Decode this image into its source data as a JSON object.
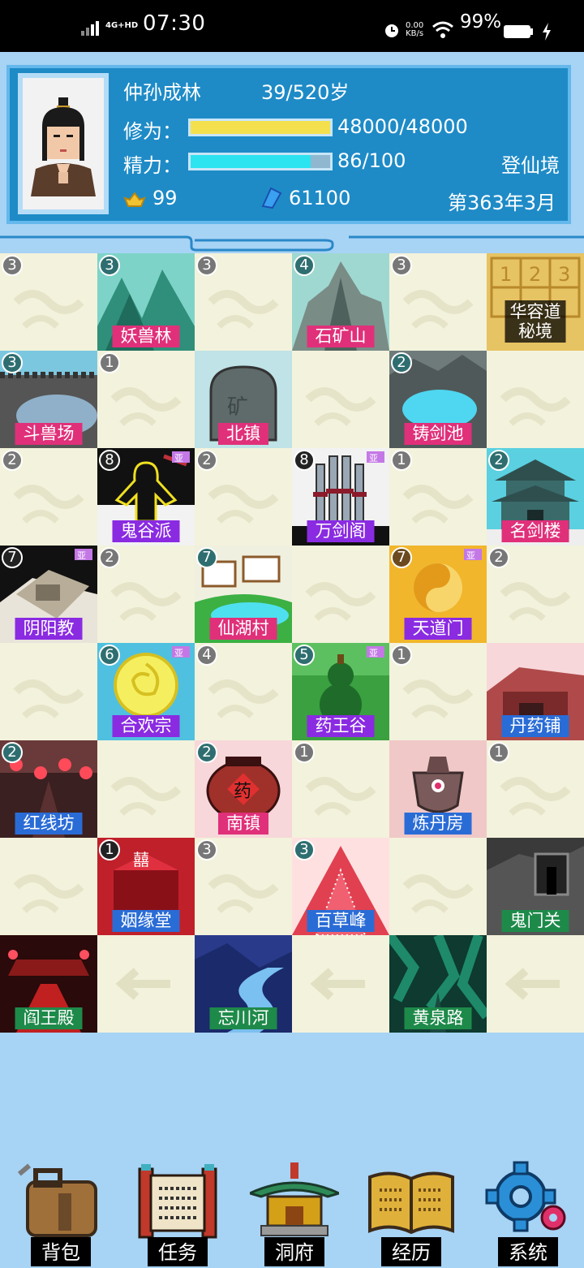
{
  "status_bar": {
    "network": "4G+HD",
    "time": "07:30",
    "net_speed_value": "0.00",
    "net_speed_unit": "KB/s",
    "battery": "99%"
  },
  "profile": {
    "name": "仲孙成林",
    "age": "39/520岁",
    "cultivation_label": "修为：",
    "cultivation_value": "48000/48000",
    "cultivation_progress": 1.0,
    "energy_label": "精力：",
    "energy_value": "86/100",
    "energy_progress": 0.86,
    "realm": "登仙境",
    "gold": "99",
    "spirit_stones": "61100",
    "date": "第363年3月"
  },
  "colors": {
    "panel": "#1e8bc7",
    "cultivation_bar": "#f4e04d",
    "energy_bar": "#2ce4ef",
    "label_pink": "#e0307a",
    "label_purple": "#8a2be2",
    "label_blue": "#2a6cd6",
    "label_green": "#1e8a4a"
  },
  "grid": {
    "rows": [
      [
        {
          "badge": "3",
          "label": "",
          "scene": "empty"
        },
        {
          "badge": "3",
          "label": "妖兽林",
          "scene": "forest",
          "label_color": "pink"
        },
        {
          "badge": "3",
          "label": "",
          "scene": "empty"
        },
        {
          "badge": "4",
          "label": "石矿山",
          "scene": "rock",
          "label_color": "pink"
        },
        {
          "badge": "3",
          "label": "",
          "scene": "empty"
        },
        {
          "badge": "",
          "label": "华容道\n秘境",
          "scene": "puzzle",
          "label_color": "dark"
        }
      ],
      [
        {
          "badge": "3",
          "label": "斗兽场",
          "scene": "arena",
          "label_color": "pink"
        },
        {
          "badge": "1",
          "label": "",
          "scene": "empty"
        },
        {
          "badge": "",
          "label": "北镇",
          "scene": "tomb",
          "label_color": "pink"
        },
        {
          "badge": "",
          "label": "",
          "scene": "empty"
        },
        {
          "badge": "2",
          "label": "铸剑池",
          "scene": "pool",
          "label_color": "pink"
        },
        {
          "badge": "",
          "label": "",
          "scene": "empty"
        }
      ],
      [
        {
          "badge": "2",
          "label": "",
          "scene": "empty"
        },
        {
          "badge": "8",
          "label": "鬼谷派",
          "scene": "ghostvalley",
          "label_color": "purple",
          "crown": true
        },
        {
          "badge": "2",
          "label": "",
          "scene": "empty"
        },
        {
          "badge": "8",
          "label": "万剑阁",
          "scene": "swords",
          "label_color": "purple",
          "crown": true
        },
        {
          "badge": "1",
          "label": "",
          "scene": "empty"
        },
        {
          "badge": "2",
          "label": "名剑楼",
          "scene": "pagoda",
          "label_color": "pink"
        }
      ],
      [
        {
          "badge": "7",
          "label": "阴阳教",
          "scene": "fort",
          "label_color": "purple",
          "crown": true
        },
        {
          "badge": "2",
          "label": "",
          "scene": "empty"
        },
        {
          "badge": "7",
          "label": "仙湖村",
          "scene": "village",
          "label_color": "pink"
        },
        {
          "badge": "",
          "label": "",
          "scene": "empty"
        },
        {
          "badge": "7",
          "label": "天道门",
          "scene": "taiji",
          "label_color": "purple",
          "crown": true
        },
        {
          "badge": "2",
          "label": "",
          "scene": "empty"
        }
      ],
      [
        {
          "badge": "",
          "label": "",
          "scene": "empty"
        },
        {
          "badge": "6",
          "label": "合欢宗",
          "scene": "flower",
          "label_color": "purple",
          "crown": true
        },
        {
          "badge": "4",
          "label": "",
          "scene": "empty"
        },
        {
          "badge": "5",
          "label": "药王谷",
          "scene": "gourd",
          "label_color": "purple",
          "crown": true
        },
        {
          "badge": "1",
          "label": "",
          "scene": "empty"
        },
        {
          "badge": "",
          "label": "丹药铺",
          "scene": "shop",
          "label_color": "blue"
        }
      ],
      [
        {
          "badge": "2",
          "label": "红线坊",
          "scene": "lanterns",
          "label_color": "blue"
        },
        {
          "badge": "",
          "label": "",
          "scene": "empty"
        },
        {
          "badge": "2",
          "label": "南镇",
          "scene": "jar",
          "label_color": "pink"
        },
        {
          "badge": "1",
          "label": "",
          "scene": "empty"
        },
        {
          "badge": "",
          "label": "炼丹房",
          "scene": "cauldron",
          "label_color": "blue"
        },
        {
          "badge": "1",
          "label": "",
          "scene": "empty"
        }
      ],
      [
        {
          "badge": "",
          "label": "",
          "scene": "empty"
        },
        {
          "badge": "1",
          "label": "姻缘堂",
          "scene": "wedding",
          "label_color": "blue"
        },
        {
          "badge": "3",
          "label": "",
          "scene": "empty"
        },
        {
          "badge": "3",
          "label": "百草峰",
          "scene": "herbpeak",
          "label_color": "blue"
        },
        {
          "badge": "",
          "label": "",
          "scene": "empty"
        },
        {
          "badge": "",
          "label": "鬼门关",
          "scene": "ghostgate",
          "label_color": "green"
        }
      ],
      [
        {
          "badge": "",
          "label": "阎王殿",
          "scene": "hellhall",
          "label_color": "green"
        },
        {
          "badge": "",
          "label": "",
          "scene": "empty_arrow"
        },
        {
          "badge": "",
          "label": "忘川河",
          "scene": "river",
          "label_color": "green"
        },
        {
          "badge": "",
          "label": "",
          "scene": "empty_arrow"
        },
        {
          "badge": "",
          "label": "黄泉路",
          "scene": "yellowspring",
          "label_color": "green"
        },
        {
          "badge": "",
          "label": "",
          "scene": "empty_arrow"
        }
      ]
    ]
  },
  "nav": [
    {
      "label": "背包",
      "icon": "backpack-icon"
    },
    {
      "label": "任务",
      "icon": "scroll-icon"
    },
    {
      "label": "洞府",
      "icon": "pavilion-icon"
    },
    {
      "label": "经历",
      "icon": "book-icon"
    },
    {
      "label": "系统",
      "icon": "gear-icon"
    }
  ]
}
